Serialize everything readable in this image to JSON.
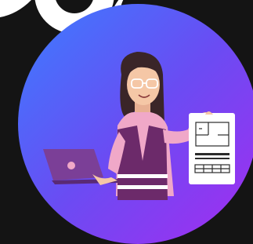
{
  "colors": {
    "background": "#141414",
    "headline_glyphs": "#ffffff",
    "circle_gradient_start": "#3b7dff",
    "circle_gradient_mid": "#6a4cf3",
    "circle_gradient_end": "#9a2ff0",
    "hair": "#3a2528",
    "skin": "#f5c7a6",
    "blouse": "#f0a8c8",
    "vest": "#6c2a6a",
    "vest_stripe": "#ffffff",
    "laptop": "#7b3f97",
    "document_paper": "#ffffff",
    "document_lines": "#2b2b2b"
  },
  "icons": [
    "laptop-icon",
    "floor-plan-document-icon",
    "glasses-icon"
  ]
}
